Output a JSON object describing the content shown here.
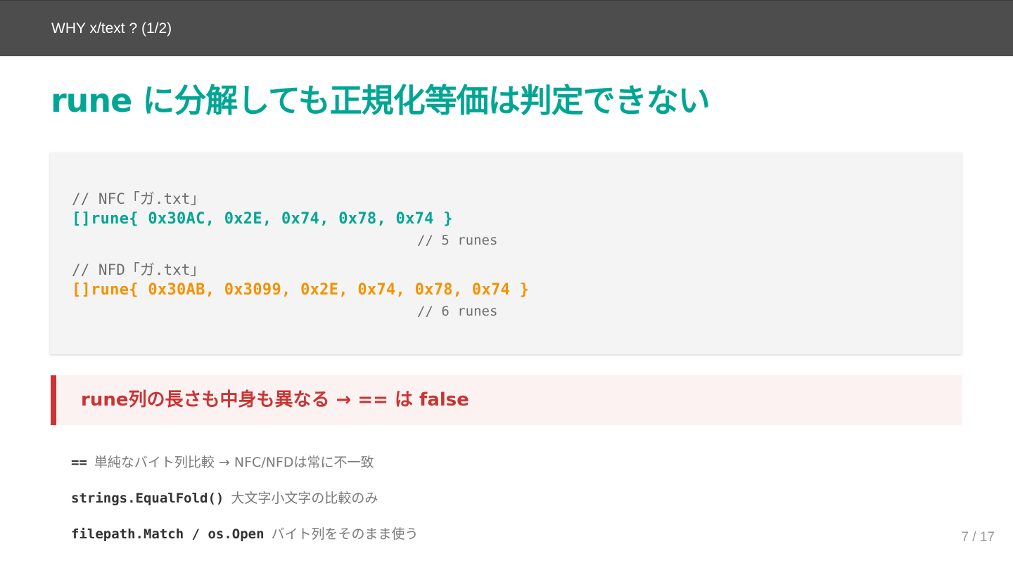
{
  "header": {
    "title": "WHY x/text ? (1/2)"
  },
  "slide": {
    "title": "rune に分解しても正規化等価は判定できない"
  },
  "code_block": {
    "nfc_comment": "// NFC「ガ.txt」",
    "nfc_code": "[]rune{ 0x30AC, 0x2E, 0x74, 0x78, 0x74 }",
    "nfc_count": "// 5 runes",
    "nfd_comment": "// NFD「ガ.txt」",
    "nfd_code": "[]rune{ 0x30AB, 0x3099, 0x2E, 0x74, 0x78, 0x74 }",
    "nfd_count": "// 6 runes"
  },
  "alert": {
    "text": "rune列の長さも中身も異なる → == は false"
  },
  "notes": [
    {
      "code": "==",
      "desc": "単純なバイト列比較 → NFC/NFDは常に不一致"
    },
    {
      "code": "strings.EqualFold()",
      "desc": "大文字小文字の比較のみ"
    },
    {
      "code": "filepath.Match / os.Open",
      "desc": "バイト列をそのまま使う"
    }
  ],
  "footer": {
    "page_number": "7 / 17"
  },
  "colors": {
    "accent_teal": "#00a693",
    "accent_orange": "#f29300",
    "alert_red": "#cc3333",
    "header_bg": "#4d4d4d"
  }
}
